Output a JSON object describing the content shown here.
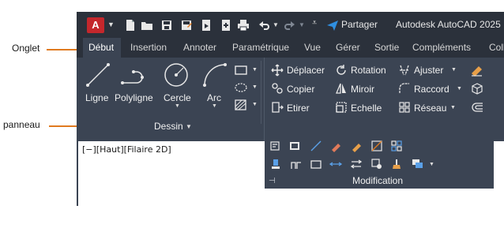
{
  "callouts": {
    "tab_label": "Onglet",
    "panel_label": "panneau"
  },
  "titlebar": {
    "share_label": "Partager",
    "app_title": "Autodesk AutoCAD 2025"
  },
  "tabs": [
    "Début",
    "Insertion",
    "Annoter",
    "Paramétrique",
    "Vue",
    "Gérer",
    "Sortie",
    "Compléments",
    "Coll"
  ],
  "draw_panel": {
    "tools": [
      "Ligne",
      "Polyligne",
      "Cercle",
      "Arc"
    ],
    "title": "Dessin"
  },
  "modify_panel": {
    "tools": [
      "Déplacer",
      "Rotation",
      "Ajuster",
      "Copier",
      "Miroir",
      "Raccord",
      "Etirer",
      "Echelle",
      "Réseau"
    ],
    "title": "Modification"
  },
  "viewport": {
    "label": "[−][Haut][Filaire 2D]"
  },
  "colors": {
    "titlebar": "#2b313b",
    "ribbon": "#3b4453",
    "callout_line": "#e07a1f",
    "app_badge": "#c4272c",
    "share_icon": "#2f8fe0"
  }
}
